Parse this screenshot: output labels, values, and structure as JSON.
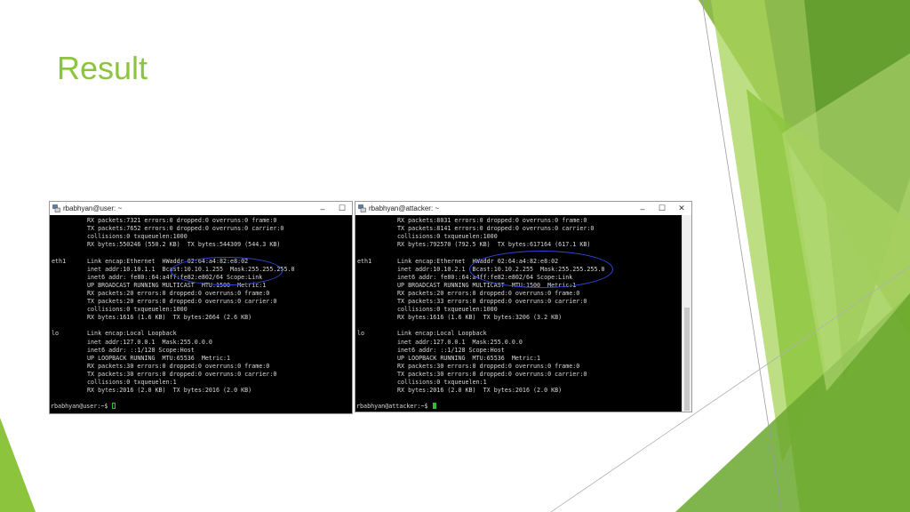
{
  "slide": {
    "title": "Result",
    "colors": {
      "title": "#8cc43d",
      "accent_dark": "#5e9a2a",
      "accent_light": "#a8d35a"
    }
  },
  "windows": [
    {
      "title": "rbabhyan@user: ~",
      "lines": [
        {
          "iface": "",
          "text": "RX packets:7321 errors:0 dropped:0 overruns:0 frame:0"
        },
        {
          "iface": "",
          "text": "TX packets:7652 errors:0 dropped:0 overruns:0 carrier:0"
        },
        {
          "iface": "",
          "text": "collisions:0 txqueuelen:1000"
        },
        {
          "iface": "",
          "text": "RX bytes:550246 (550.2 KB)  TX bytes:544309 (544.3 KB)"
        },
        {
          "iface": "",
          "text": ""
        },
        {
          "iface": "eth1",
          "text": "Link encap:Ethernet  HWaddr 02:64:a4:82:e8:02"
        },
        {
          "iface": "",
          "text": "inet addr:10.10.1.1  Bcast:10.10.1.255  Mask:255.255.255.0"
        },
        {
          "iface": "",
          "text": "inet6 addr: fe80::64:a4ff:fe82:e802/64 Scope:Link"
        },
        {
          "iface": "",
          "text": "UP BROADCAST RUNNING MULTICAST  MTU:1500  Metric:1"
        },
        {
          "iface": "",
          "text": "RX packets:20 errors:0 dropped:0 overruns:0 frame:0"
        },
        {
          "iface": "",
          "text": "TX packets:20 errors:0 dropped:0 overruns:0 carrier:0"
        },
        {
          "iface": "",
          "text": "collisions:0 txqueuelen:1000"
        },
        {
          "iface": "",
          "text": "RX bytes:1616 (1.6 KB)  TX bytes:2664 (2.6 KB)"
        },
        {
          "iface": "",
          "text": ""
        },
        {
          "iface": "lo",
          "text": "Link encap:Local Loopback"
        },
        {
          "iface": "",
          "text": "inet addr:127.0.0.1  Mask:255.0.0.0"
        },
        {
          "iface": "",
          "text": "inet6 addr: ::1/128 Scope:Host"
        },
        {
          "iface": "",
          "text": "UP LOOPBACK RUNNING  MTU:65536  Metric:1"
        },
        {
          "iface": "",
          "text": "RX packets:30 errors:0 dropped:0 overruns:0 frame:0"
        },
        {
          "iface": "",
          "text": "TX packets:30 errors:0 dropped:0 overruns:0 carrier:0"
        },
        {
          "iface": "",
          "text": "collisions:0 txqueuelen:1"
        },
        {
          "iface": "",
          "text": "RX bytes:2016 (2.0 KB)  TX bytes:2016 (2.0 KB)"
        },
        {
          "iface": "",
          "text": ""
        }
      ],
      "prompt": "rbabhyan@user:~$ "
    },
    {
      "title": "rbabhyan@attacker: ~",
      "lines": [
        {
          "iface": "",
          "text": "RX packets:8031 errors:0 dropped:0 overruns:0 frame:0"
        },
        {
          "iface": "",
          "text": "TX packets:8141 errors:0 dropped:0 overruns:0 carrier:0"
        },
        {
          "iface": "",
          "text": "collisions:0 txqueuelen:1000"
        },
        {
          "iface": "",
          "text": "RX bytes:792570 (792.5 KB)  TX bytes:617164 (617.1 KB)"
        },
        {
          "iface": "",
          "text": ""
        },
        {
          "iface": "eth1",
          "text": "Link encap:Ethernet  HWaddr 02:64:a4:82:e8:02"
        },
        {
          "iface": "",
          "text": "inet addr:10.10.2.1  Bcast:10.10.2.255  Mask:255.255.255.0"
        },
        {
          "iface": "",
          "text": "inet6 addr: fe80::64:a4ff:fe82:e802/64 Scope:Link"
        },
        {
          "iface": "",
          "text": "UP BROADCAST RUNNING MULTICAST  MTU:1500  Metric:1"
        },
        {
          "iface": "",
          "text": "RX packets:20 errors:0 dropped:0 overruns:0 frame:0"
        },
        {
          "iface": "",
          "text": "TX packets:33 errors:0 dropped:0 overruns:0 carrier:0"
        },
        {
          "iface": "",
          "text": "collisions:0 txqueuelen:1000"
        },
        {
          "iface": "",
          "text": "RX bytes:1616 (1.6 KB)  TX bytes:3206 (3.2 KB)"
        },
        {
          "iface": "",
          "text": ""
        },
        {
          "iface": "lo",
          "text": "Link encap:Local Loopback"
        },
        {
          "iface": "",
          "text": "inet addr:127.0.0.1  Mask:255.0.0.0"
        },
        {
          "iface": "",
          "text": "inet6 addr: ::1/128 Scope:Host"
        },
        {
          "iface": "",
          "text": "UP LOOPBACK RUNNING  MTU:65536  Metric:1"
        },
        {
          "iface": "",
          "text": "RX packets:30 errors:0 dropped:0 overruns:0 frame:0"
        },
        {
          "iface": "",
          "text": "TX packets:30 errors:0 dropped:0 overruns:0 carrier:0"
        },
        {
          "iface": "",
          "text": "collisions:0 txqueuelen:1"
        },
        {
          "iface": "",
          "text": "RX bytes:2016 (2.0 KB)  TX bytes:2016 (2.0 KB)"
        },
        {
          "iface": "",
          "text": ""
        }
      ],
      "prompt": "rbabhyan@attacker:~$ "
    }
  ],
  "window_buttons": {
    "minimize": "–",
    "maximize": "☐",
    "close": "✕"
  },
  "terminal_colors": {
    "background": "#000000",
    "text": "#d8d8d8",
    "cursor": "#2ec22e",
    "annotation": "#3248d6"
  }
}
